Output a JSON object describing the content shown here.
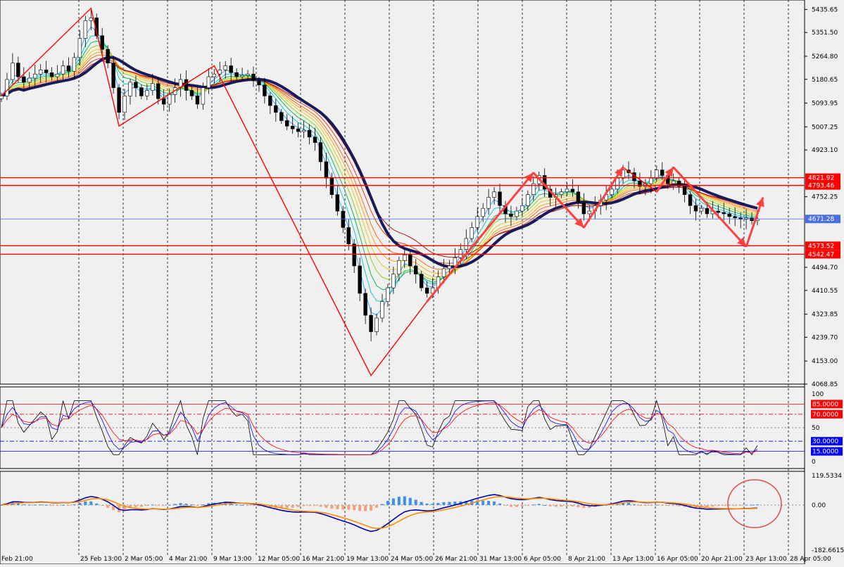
{
  "chart_data": [
    {
      "type": "candlestick",
      "panel": "main",
      "ylim": [
        4068.85,
        5470
      ],
      "yticks": [
        "5435.65",
        "5351.50",
        "5264.80",
        "5180.65",
        "5093.95",
        "5007.25",
        "4923.10",
        "4752.25",
        "4494.70",
        "4410.55",
        "4323.85",
        "4239.70",
        "4153.00",
        "4068.85"
      ],
      "date_labels": [
        "Feb 21:00",
        "25 Feb 13:00",
        "2 Mar 05:00",
        "4 Mar 21:00",
        "9 Mar 13:00",
        "12 Mar 05:00",
        "16 Mar 21:00",
        "19 Mar 13:00",
        "24 Mar 05:00",
        "26 Mar 21:00",
        "31 Mar 13:00",
        "6 Apr 05:00",
        "8 Apr 21:00",
        "13 Apr 13:00",
        "16 Apr 05:00",
        "20 Apr 21:00",
        "23 Apr 13:00",
        "28 Apr 05:00"
      ],
      "horizontal_levels": [
        {
          "value": 4821.92,
          "label": "4821.92",
          "color": "#ff0000"
        },
        {
          "value": 4793.46,
          "label": "4793.46",
          "color": "#ff0000"
        },
        {
          "value": 4671.28,
          "label": "4671.28",
          "color": "#4a6fe0"
        },
        {
          "value": 4573.52,
          "label": "4573.52",
          "color": "#ff0000"
        },
        {
          "value": 4542.47,
          "label": "4542.47",
          "color": "#ff0000"
        }
      ],
      "close_series": [
        5120,
        5180,
        5240,
        5190,
        5170,
        5185,
        5200,
        5215,
        5205,
        5190,
        5200,
        5230,
        5210,
        5260,
        5330,
        5395,
        5405,
        5340,
        5290,
        5240,
        5150,
        5060,
        5120,
        5170,
        5150,
        5120,
        5140,
        5165,
        5110,
        5090,
        5125,
        5150,
        5180,
        5140,
        5120,
        5090,
        5150,
        5190,
        5200,
        5215,
        5230,
        5205,
        5190,
        5195,
        5200,
        5175,
        5160,
        5120,
        5085,
        5060,
        5030,
        5010,
        5000,
        4990,
        4995,
        4970,
        4950,
        4880,
        4820,
        4760,
        4700,
        4640,
        4580,
        4500,
        4400,
        4320,
        4260,
        4310,
        4370,
        4420,
        4470,
        4520,
        4540,
        4500,
        4470,
        4420,
        4400,
        4420,
        4460,
        4490,
        4500,
        4530,
        4560,
        4600,
        4640,
        4680,
        4710,
        4750,
        4770,
        4720,
        4690,
        4680,
        4700,
        4720,
        4760,
        4800,
        4830,
        4780,
        4750,
        4760,
        4770,
        4780,
        4770,
        4730,
        4690,
        4700,
        4720,
        4740,
        4760,
        4780,
        4820,
        4850,
        4840,
        4810,
        4790,
        4800,
        4820,
        4850,
        4830,
        4800,
        4810,
        4790,
        4760,
        4720,
        4700,
        4710,
        4690,
        4700,
        4695,
        4690,
        4680,
        4675,
        4670,
        4675,
        4665,
        4671
      ]
    },
    {
      "type": "line",
      "panel": "oscillator",
      "ylim": [
        0,
        100
      ],
      "yticks": [
        "100",
        "50",
        "0"
      ],
      "levels": [
        {
          "value": 85,
          "label": "85.0000",
          "color": "#ff0000"
        },
        {
          "value": 70,
          "label": "70.0000",
          "color": "#ff0000"
        },
        {
          "value": 30,
          "label": "30.0000",
          "color": "#0000ff"
        },
        {
          "value": 15,
          "label": "15.0000",
          "color": "#0000ff"
        }
      ]
    },
    {
      "type": "bar",
      "panel": "macd",
      "ylim": [
        -182.6615,
        119.5334
      ],
      "yticks": [
        "119.5334",
        "0.00",
        "-182.6615"
      ]
    }
  ]
}
